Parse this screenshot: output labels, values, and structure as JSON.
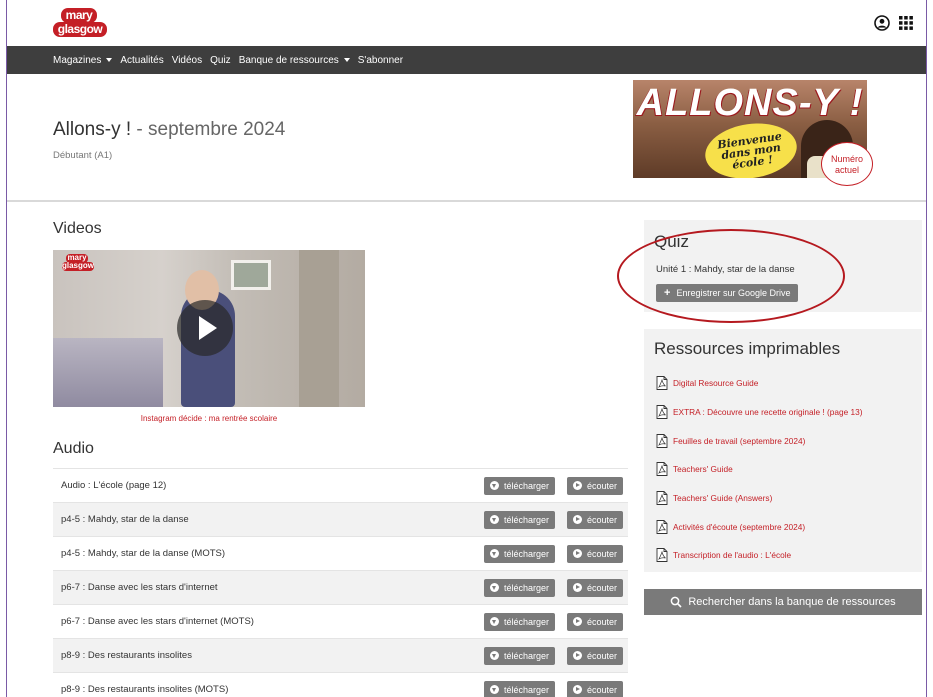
{
  "brand": {
    "logo_line1": "mary",
    "logo_line2": "glasgow"
  },
  "nav": {
    "items": [
      {
        "label": "Magazines",
        "dropdown": true
      },
      {
        "label": "Actualités",
        "dropdown": false
      },
      {
        "label": "Vidéos",
        "dropdown": false
      },
      {
        "label": "Quiz",
        "dropdown": false
      },
      {
        "label": "Banque de ressources",
        "dropdown": true
      },
      {
        "label": "S'abonner",
        "dropdown": false
      }
    ]
  },
  "header": {
    "magazine": "Allons-y !",
    "separator": " - ",
    "issue": "septembre 2024",
    "level": "Débutant (A1)",
    "cover_title": "ALLONS-Y !",
    "cover_bubble": [
      "Bienvenue",
      "dans mon",
      "école !"
    ],
    "badge_line1": "Numéro",
    "badge_line2": "actuel"
  },
  "videos": {
    "heading": "Videos",
    "caption": "Instagram décide : ma rentrée scolaire"
  },
  "audio": {
    "heading": "Audio",
    "download_label": "télécharger",
    "listen_label": "écouter",
    "rows": [
      "Audio : L'école (page 12)",
      "p4-5 : Mahdy, star de la danse",
      "p4-5 : Mahdy, star de la danse (MOTS)",
      "p6-7 : Danse avec les stars d'internet",
      "p6-7 : Danse avec les stars d'internet (MOTS)",
      "p8-9 : Des restaurants insolites",
      "p8-9 : Des restaurants insolites (MOTS)"
    ]
  },
  "quiz": {
    "heading": "Quiz",
    "item": "Unité 1 : Mahdy, star de la danse",
    "drive_button": "Enregistrer sur Google Drive"
  },
  "resources": {
    "heading": "Ressources imprimables",
    "items": [
      "Digital Resource Guide",
      "EXTRA : Découvre une recette originale ! (page 13)",
      "Feuilles de travail (septembre 2024)",
      "Teachers' Guide",
      "Teachers' Guide (Answers)",
      "Activités d'écoute (septembre 2024)",
      "Transcription de l'audio : L'école"
    ]
  },
  "search": {
    "label": "Rechercher dans la banque de ressources"
  },
  "colors": {
    "accent": "#c41f26",
    "nav_bg": "#3e3e3e",
    "button_bg": "#7a7a7a",
    "panel_bg": "#f2f2f2",
    "highlight_ellipse": "#b5191f"
  }
}
